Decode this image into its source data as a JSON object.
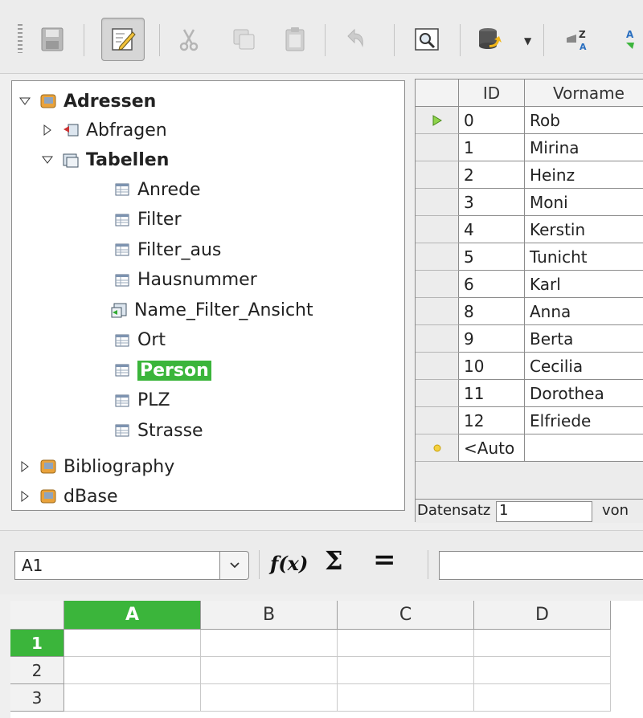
{
  "tree": {
    "root": "Adressen",
    "queries": "Abfragen",
    "tables": "Tabellen",
    "table_items": [
      "Anrede",
      "Filter",
      "Filter_aus",
      "Hausnummer",
      "Name_Filter_Ansicht",
      "Ort",
      "Person",
      "PLZ",
      "Strasse"
    ],
    "other_dbs": [
      "Bibliography",
      "dBase"
    ]
  },
  "grid": {
    "columns": [
      "ID",
      "Vorname"
    ],
    "rows": [
      [
        "0",
        "Rob"
      ],
      [
        "1",
        "Mirina"
      ],
      [
        "2",
        "Heinz"
      ],
      [
        "3",
        "Moni"
      ],
      [
        "4",
        "Kerstin"
      ],
      [
        "5",
        "Tunicht"
      ],
      [
        "6",
        "Karl"
      ],
      [
        "8",
        "Anna"
      ],
      [
        "9",
        "Berta"
      ],
      [
        "10",
        "Cecilia"
      ],
      [
        "11",
        "Dorothea"
      ],
      [
        "12",
        "Elfriede"
      ]
    ],
    "new_row": "<Auto",
    "nav_label": "Datensatz",
    "nav_value": "1",
    "nav_of": "von"
  },
  "formula": {
    "name_box": "A1",
    "fx": "f(x)",
    "sum": "Σ",
    "equals": "="
  },
  "sheet": {
    "columns": [
      "A",
      "B",
      "C",
      "D"
    ],
    "rows": [
      "1",
      "2",
      "3"
    ]
  },
  "colors": {
    "selection_green": "#3bb53b"
  }
}
